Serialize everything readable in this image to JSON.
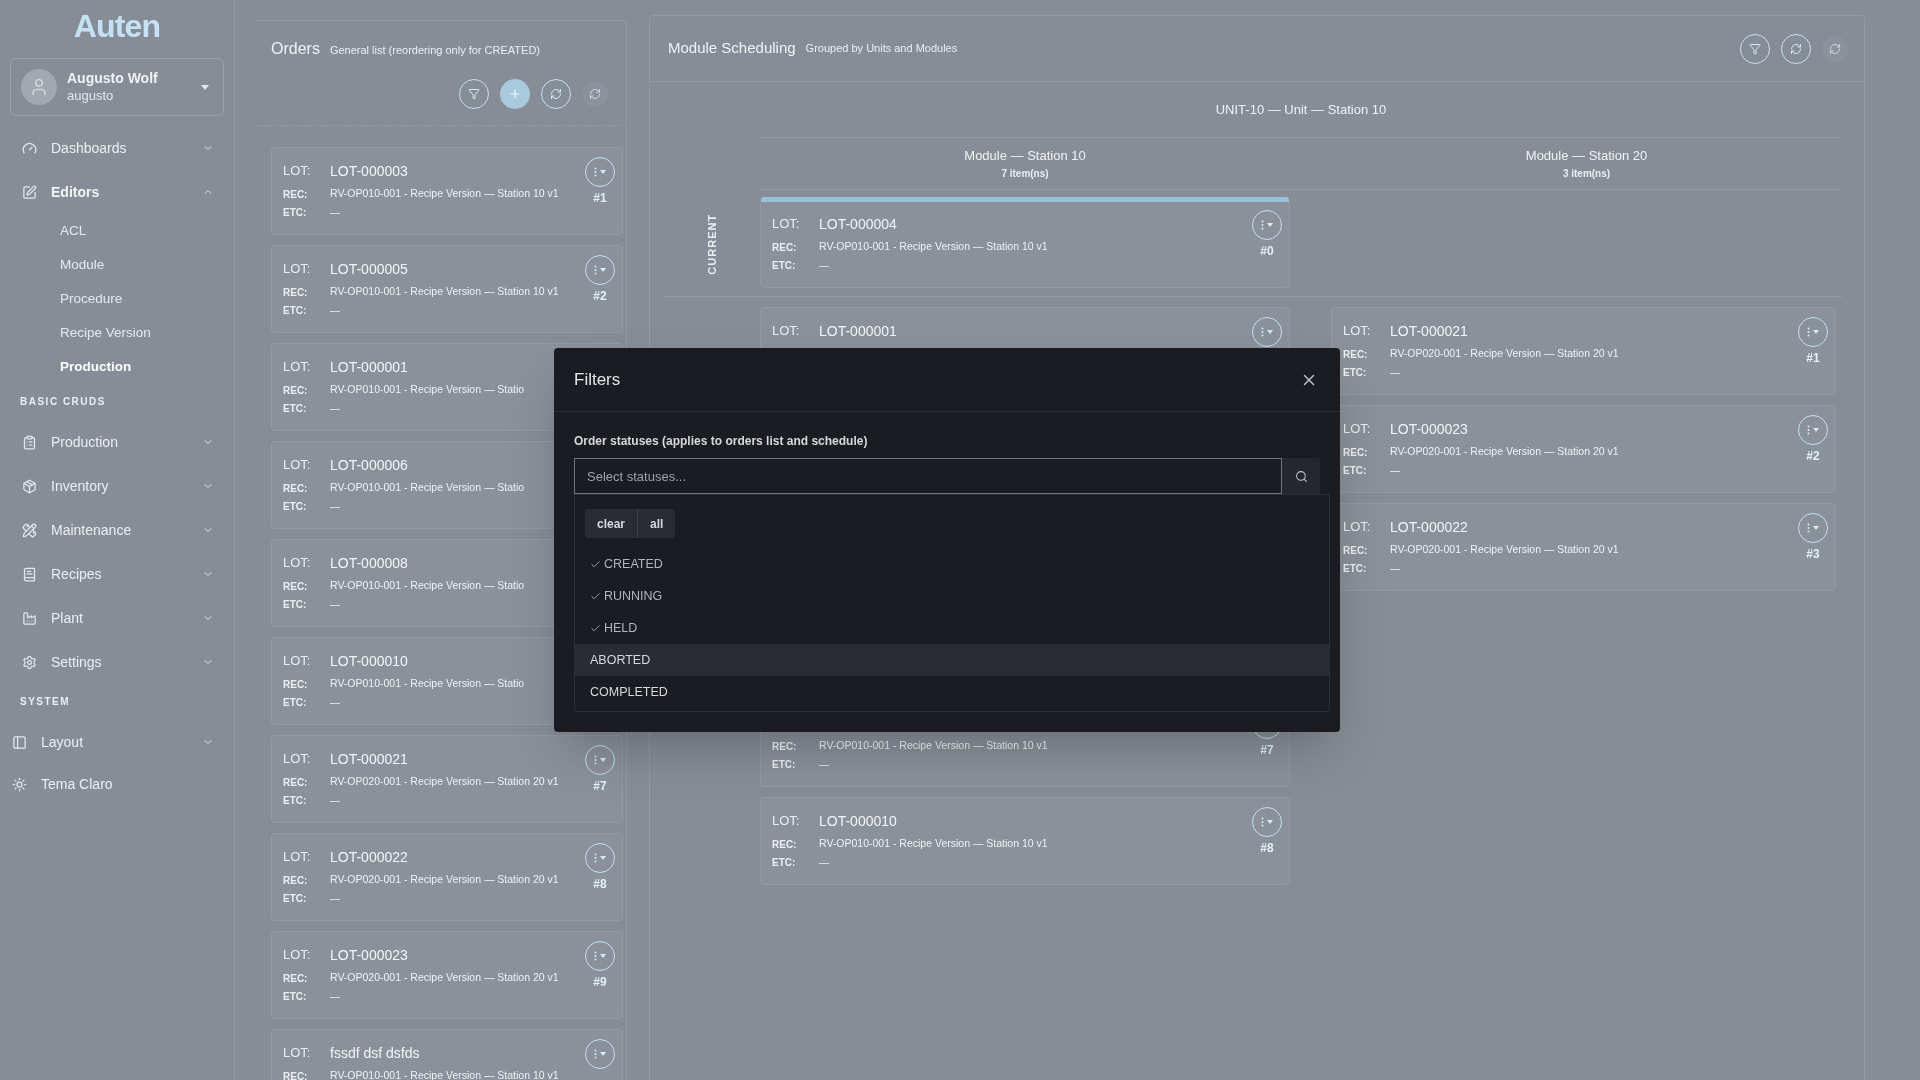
{
  "sidebar": {
    "logo": "Auten",
    "user": {
      "name": "Augusto Wolf",
      "username": "augusto"
    },
    "nav": [
      {
        "kind": "item",
        "label": "Dashboards",
        "expanded": false
      },
      {
        "kind": "item",
        "label": "Editors",
        "expanded": true,
        "children": [
          {
            "label": "ACL",
            "selected": false
          },
          {
            "label": "Module",
            "selected": false
          },
          {
            "label": "Procedure",
            "selected": false
          },
          {
            "label": "Recipe Version",
            "selected": false
          },
          {
            "label": "Production",
            "selected": true
          }
        ]
      },
      {
        "kind": "section",
        "label": "BASIC CRUDS"
      },
      {
        "kind": "item",
        "label": "Production",
        "expanded": false
      },
      {
        "kind": "item",
        "label": "Inventory",
        "expanded": false
      },
      {
        "kind": "item",
        "label": "Maintenance",
        "expanded": false
      },
      {
        "kind": "item",
        "label": "Recipes",
        "expanded": false
      },
      {
        "kind": "item",
        "label": "Plant",
        "expanded": false
      },
      {
        "kind": "item",
        "label": "Settings",
        "expanded": false
      },
      {
        "kind": "section",
        "label": "SYSTEM"
      },
      {
        "kind": "item",
        "label": "Layout",
        "expanded": false
      },
      {
        "kind": "toggle",
        "label": "Tema Claro"
      }
    ]
  },
  "orders": {
    "title": "Orders",
    "subtitle": "General list (reordering only for CREATED)",
    "cards": [
      {
        "lot_label": "LOT:",
        "lot": "LOT-000003",
        "rec_label": "REC:",
        "rec": "RV-OP010-001 - Recipe Version — Station 10 v1",
        "etc_label": "ETC:",
        "etc": "—",
        "has_menu": true,
        "number": "#1"
      },
      {
        "lot_label": "LOT:",
        "lot": "LOT-000005",
        "rec_label": "REC:",
        "rec": "RV-OP010-001 - Recipe Version — Station 10 v1",
        "etc_label": "ETC:",
        "etc": "—",
        "has_menu": true,
        "number": "#2"
      },
      {
        "lot_label": "LOT:",
        "lot": "LOT-000001",
        "rec_label": "REC:",
        "rec": "RV-OP010-001 - Recipe Version — Statio",
        "etc_label": "ETC:",
        "etc": "—"
      },
      {
        "lot_label": "LOT:",
        "lot": "LOT-000006",
        "rec_label": "REC:",
        "rec": "RV-OP010-001 - Recipe Version — Statio",
        "etc_label": "ETC:",
        "etc": "—"
      },
      {
        "lot_label": "LOT:",
        "lot": "LOT-000008",
        "rec_label": "REC:",
        "rec": "RV-OP010-001 - Recipe Version — Statio",
        "etc_label": "ETC:",
        "etc": "—"
      },
      {
        "lot_label": "LOT:",
        "lot": "LOT-000010",
        "rec_label": "REC:",
        "rec": "RV-OP010-001 - Recipe Version — Statio",
        "etc_label": "ETC:",
        "etc": "—"
      },
      {
        "lot_label": "LOT:",
        "lot": "LOT-000021",
        "rec_label": "REC:",
        "rec": "RV-OP020-001 - Recipe Version — Station 20 v1",
        "etc_label": "ETC:",
        "etc": "—",
        "has_menu": true,
        "number": "#7"
      },
      {
        "lot_label": "LOT:",
        "lot": "LOT-000022",
        "rec_label": "REC:",
        "rec": "RV-OP020-001 - Recipe Version — Station 20 v1",
        "etc_label": "ETC:",
        "etc": "—",
        "has_menu": true,
        "number": "#8"
      },
      {
        "lot_label": "LOT:",
        "lot": "LOT-000023",
        "rec_label": "REC:",
        "rec": "RV-OP020-001 - Recipe Version — Station 20 v1",
        "etc_label": "ETC:",
        "etc": "—",
        "has_menu": true,
        "number": "#9"
      },
      {
        "lot_label": "LOT:",
        "lot": "fssdf dsf dsfds",
        "rec_label": "REC:",
        "rec": "RV-OP010-001 - Recipe Version — Station 10 v1",
        "has_menu": true
      }
    ]
  },
  "schedule": {
    "title": "Module Scheduling",
    "subtitle": "Grouped by Units and Modules",
    "unit": "UNIT-10 — Unit — Station 10",
    "current_label": "CURRENT",
    "columns": [
      {
        "title": "Module — Station 10",
        "count": "7 item(ns)",
        "current": {
          "lot_label": "LOT:",
          "lot": "LOT-000004",
          "rec_label": "REC:",
          "rec": "RV-OP010-001 - Recipe Version — Station 10 v1",
          "etc_label": "ETC:",
          "etc": "—",
          "has_menu": true,
          "number": "#0"
        },
        "queue": [
          {
            "kind": "card",
            "lot_label": "LOT:",
            "lot": "LOT-000001",
            "has_menu": true
          },
          {
            "kind": "hidden"
          },
          {
            "kind": "hidden"
          },
          {
            "kind": "hidden"
          },
          {
            "kind": "card",
            "rec_label": "REC:",
            "rec": "RV-OP010-001 - Recipe Version — Station 10 v1",
            "etc_label": "ETC:",
            "etc": "—",
            "has_menu": true,
            "number": "#7"
          },
          {
            "kind": "card",
            "lot_label": "LOT:",
            "lot": "LOT-000010",
            "rec_label": "REC:",
            "rec": "RV-OP010-001 - Recipe Version — Station 10 v1",
            "etc_label": "ETC:",
            "etc": "—",
            "has_menu": true,
            "number": "#8"
          }
        ]
      },
      {
        "title": "Module — Station 20",
        "count": "3 item(ns)",
        "queue": [
          {
            "kind": "card",
            "lot_label": "LOT:",
            "lot": "LOT-000021",
            "rec_label": "REC:",
            "rec": "RV-OP020-001 - Recipe Version — Station 20 v1",
            "etc_label": "ETC:",
            "etc": "—",
            "has_menu": true,
            "number": "#1"
          },
          {
            "kind": "card",
            "lot_label": "LOT:",
            "lot": "LOT-000023",
            "rec_label": "REC:",
            "rec": "RV-OP020-001 - Recipe Version — Station 20 v1",
            "etc_label": "ETC:",
            "etc": "—",
            "has_menu": true,
            "number": "#2"
          },
          {
            "kind": "card",
            "lot_label": "LOT:",
            "lot": "LOT-000022",
            "rec_label": "REC:",
            "rec": "RV-OP020-001 - Recipe Version — Station 20 v1",
            "etc_label": "ETC:",
            "etc": "—",
            "has_menu": true,
            "number": "#3"
          }
        ]
      }
    ]
  },
  "filters": {
    "title": "Filters",
    "field_label": "Order statuses (applies to orders list and schedule)",
    "placeholder": "Select statuses...",
    "clear": "clear",
    "all": "all",
    "options": [
      {
        "label": "CREATED",
        "checked": true,
        "highlighted": false
      },
      {
        "label": "RUNNING",
        "checked": true,
        "highlighted": false
      },
      {
        "label": "HELD",
        "checked": true,
        "highlighted": false
      },
      {
        "label": "ABORTED",
        "checked": false,
        "highlighted": true
      },
      {
        "label": "COMPLETED",
        "checked": false,
        "highlighted": false
      }
    ]
  }
}
